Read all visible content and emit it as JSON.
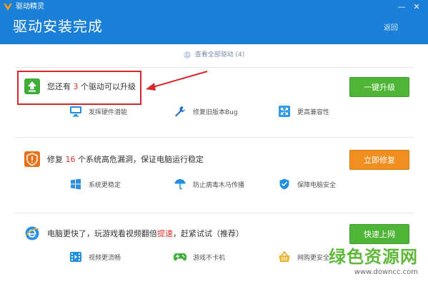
{
  "window": {
    "app_name": "驱动精灵",
    "minimize_symbol": "—",
    "close_symbol": "✕"
  },
  "header": {
    "title": "驱动安装完成",
    "back_label": "返回"
  },
  "view_all": {
    "label": "查看全部驱动 (4)"
  },
  "sections": [
    {
      "text_before": "您还有 ",
      "count": "3",
      "text_after": " 个驱动可以升级",
      "button_label": "一键升级",
      "features": [
        {
          "icon": "monitor-icon",
          "label": "发挥硬件潜能"
        },
        {
          "icon": "wrench-icon",
          "label": "修复旧版本Bug"
        },
        {
          "icon": "expand-icon",
          "label": "更高兼容性"
        }
      ]
    },
    {
      "text_before": "修复 ",
      "count": "16",
      "text_after": " 个系统高危漏洞，保证电脑运行稳定",
      "button_label": "立即修复",
      "features": [
        {
          "icon": "windows-icon",
          "label": "系统更稳定"
        },
        {
          "icon": "umbrella-icon",
          "label": "防止病毒木马传播"
        },
        {
          "icon": "shield-check-icon",
          "label": "保障电脑安全"
        }
      ]
    },
    {
      "text_before": "电脑更快了，玩游戏看视频翻倍",
      "count": "提速",
      "text_after": "，赶紧试试（推荐）",
      "button_label": "快速上网",
      "features": [
        {
          "icon": "video-icon",
          "label": "视频更流畅"
        },
        {
          "icon": "gamepad-icon",
          "label": "游戏不卡机"
        },
        {
          "icon": "shopping-basket-icon",
          "label": "网购更安全"
        }
      ]
    }
  ],
  "watermark": {
    "main": "绿色资源网",
    "url": "www.downcc.com"
  },
  "colors": {
    "header_bg": "#1a7fd6",
    "green_button": "#4fb536",
    "orange_button": "#f08f1f",
    "highlight_red": "#d8262c"
  }
}
